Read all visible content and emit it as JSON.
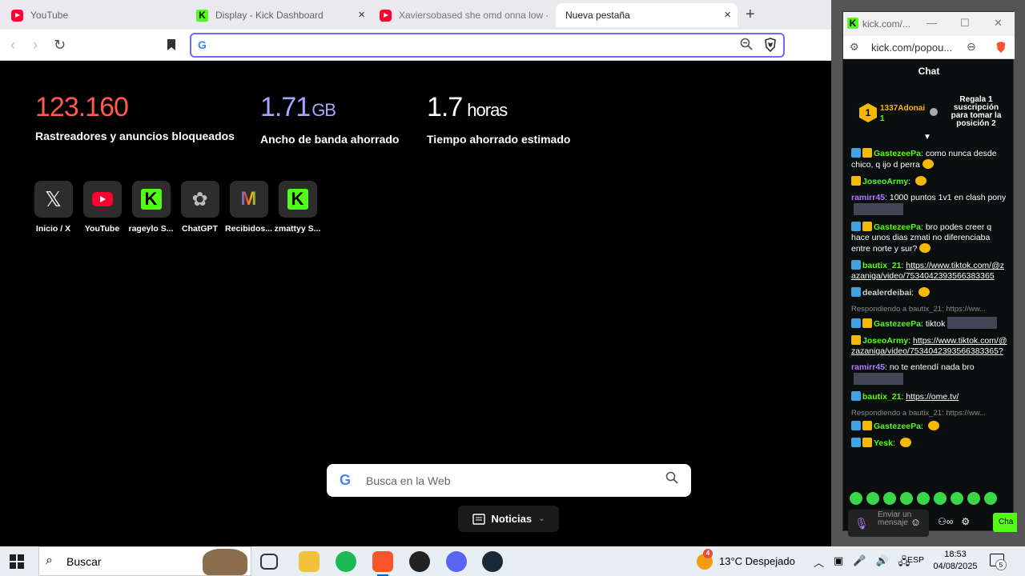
{
  "browser": {
    "tabs": [
      {
        "title": "YouTube",
        "icon": "youtube-icon",
        "active": false
      },
      {
        "title": "Display - Kick Dashboard",
        "icon": "kick-icon",
        "active": false
      },
      {
        "title": "Xaviersobased she omd onna low - Y",
        "icon": "youtube-icon",
        "active": false
      },
      {
        "title": "Nueva pestaña",
        "icon": "none",
        "active": true
      }
    ],
    "new_tab_symbol": "+",
    "close_symbol": "×",
    "omnibox_value": ""
  },
  "ntp": {
    "stats": [
      {
        "number": "123.160",
        "unit": "",
        "label": "Rastreadores y anuncios bloqueados",
        "color": "#ff5a4e"
      },
      {
        "number": "1.71",
        "unit": "GB",
        "label": "Ancho de banda ahorrado",
        "color": "#a6a6ff"
      },
      {
        "number": "1.7",
        "unit": "horas",
        "label": "Tiempo ahorrado estimado",
        "color": "#ffffff"
      }
    ],
    "tiles": [
      {
        "name": "Inicio / X",
        "icon": "x-icon"
      },
      {
        "name": "YouTube",
        "icon": "youtube-icon"
      },
      {
        "name": "rageylo S...",
        "icon": "kick-icon"
      },
      {
        "name": "ChatGPT",
        "icon": "chatgpt-icon"
      },
      {
        "name": "Recibidos...",
        "icon": "gmail-icon"
      },
      {
        "name": "zmattyy S...",
        "icon": "kick-icon"
      }
    ],
    "search_placeholder": "Busca en la Web",
    "news_label": "Noticias"
  },
  "popup": {
    "title": "kick.com/...",
    "address": "kick.com/popou...",
    "chat_title": "Chat",
    "pinned": {
      "rank": "1",
      "user": "1337Adonai",
      "count": "1",
      "text": "Regala 1 suscripción para tomar la posición 2"
    },
    "messages": [
      {
        "reply": "",
        "user": "GastezeePa",
        "color": "green",
        "badges": [
          "blue",
          "gold"
        ],
        "text": "como nunca desde chico, q ijo d perra",
        "link": "",
        "emote": true,
        "image": false
      },
      {
        "reply": "",
        "user": "JoseoArmy",
        "color": "green",
        "badges": [
          "gold"
        ],
        "text": "",
        "link": "",
        "emote": true,
        "image": false
      },
      {
        "reply": "",
        "user": "ramirr45",
        "color": "purple",
        "badges": [],
        "text": "1000 puntos 1v1 en clash pony",
        "link": "",
        "emote": false,
        "image": true
      },
      {
        "reply": "",
        "user": "GastezeePa",
        "color": "green",
        "badges": [
          "blue",
          "gold"
        ],
        "text": "bro podes creer q hace unos dias zmati no diferenciaba entre norte y sur?",
        "link": "",
        "emote": true,
        "image": false
      },
      {
        "reply": "",
        "user": "bautix_21",
        "color": "green",
        "badges": [
          "blue"
        ],
        "text": "",
        "link": "https://www.tiktok.com/@zazaniga/video/7534042393566383365",
        "emote": false,
        "image": false
      },
      {
        "reply": "",
        "user": "dealerdeibai",
        "color": "white",
        "badges": [
          "blue"
        ],
        "text": "",
        "link": "",
        "emote": true,
        "image": false
      },
      {
        "reply": "Respondiendo a bautix_21: https://ww...",
        "user": "GastezeePa",
        "color": "green",
        "badges": [
          "blue",
          "gold"
        ],
        "text": "tiktok",
        "link": "",
        "emote": false,
        "image": true
      },
      {
        "reply": "",
        "user": "JoseoArmy",
        "color": "green",
        "badges": [
          "gold"
        ],
        "text": "",
        "link": "https://www.tiktok.com/@zazaniga/video/7534042393566383365?",
        "emote": false,
        "image": false
      },
      {
        "reply": "",
        "user": "ramirr45",
        "color": "purple",
        "badges": [],
        "text": "no te entendí nada bro",
        "link": "",
        "emote": false,
        "image": true
      },
      {
        "reply": "",
        "user": "bautix_21",
        "color": "green",
        "badges": [
          "blue"
        ],
        "text": "",
        "link": "https://ome.tv/",
        "emote": false,
        "image": false
      },
      {
        "reply": "Respondiendo a bautix_21: https://ww...",
        "user": "GastezeePa",
        "color": "green",
        "badges": [
          "blue",
          "gold"
        ],
        "text": "",
        "link": "",
        "emote": true,
        "image": false
      },
      {
        "reply": "",
        "user": "Yesk",
        "color": "green",
        "badges": [
          "blue",
          "gold"
        ],
        "text": "",
        "link": "",
        "emote": true,
        "image": false
      }
    ],
    "input_placeholder": "Enviar un mensaje",
    "send_label": "Cha"
  },
  "taskbar": {
    "search_placeholder": "Buscar",
    "weather": "13°C  Despejado",
    "weather_badge": "4",
    "language": "ESP",
    "time": "18:53",
    "date": "04/08/2025",
    "notifications": "5"
  }
}
